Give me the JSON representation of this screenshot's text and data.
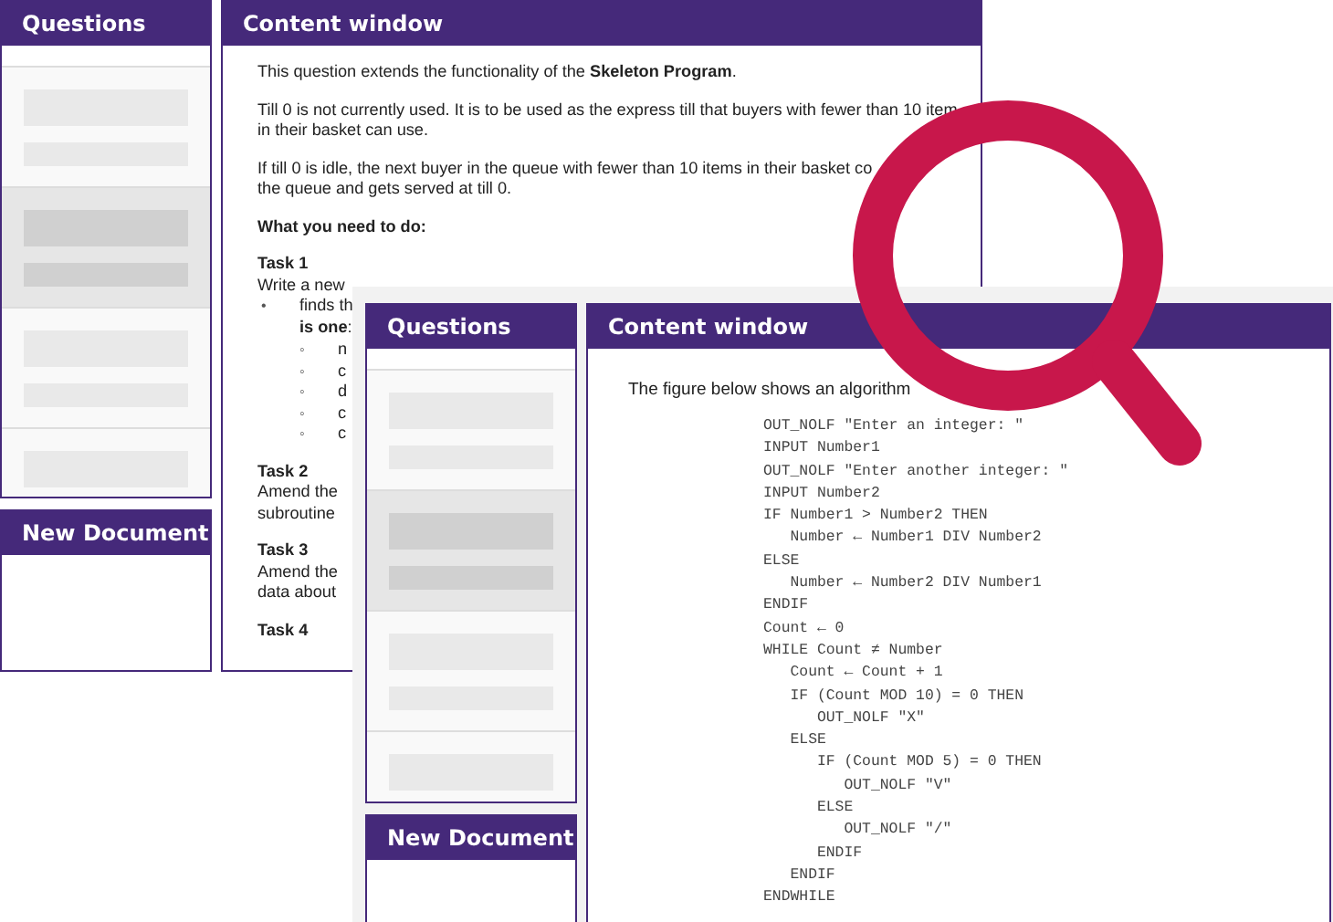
{
  "back_app": {
    "questions": {
      "title": "Questions",
      "items": [
        {
          "selected": false
        },
        {
          "selected": true
        },
        {
          "selected": false
        },
        {
          "selected": false
        }
      ]
    },
    "new_document": {
      "title": "New Document"
    },
    "content": {
      "title": "Content window",
      "blocks": [
        {
          "kind": "para",
          "lines": [
            "This question extends the functionality of the **Skeleton Program**."
          ]
        },
        {
          "kind": "para",
          "lines": [
            "Till 0 is not currently used. It is to be used as the express till that buyers with fewer than 10 item",
            "in their basket can use."
          ]
        },
        {
          "kind": "para",
          "lines": [
            "If till 0 is idle, the next buyer in the queue with fewer than 10 items in their basket co",
            "the queue and gets served at till 0."
          ]
        },
        {
          "kind": "heading",
          "lines": [
            "What you need to do:"
          ]
        },
        {
          "kind": "task",
          "lines": [
            "Task 1",
            "Write a new"
          ]
        },
        {
          "kind": "bullet",
          "mark": "•",
          "lines": [
            "finds th",
            "**is one**:"
          ]
        },
        {
          "kind": "subbullets",
          "mark": "◦",
          "lines": [
            "n",
            "c",
            "d",
            "c",
            "c"
          ]
        },
        {
          "kind": "task",
          "lines": [
            "Task 2",
            "Amend the",
            "subroutine"
          ]
        },
        {
          "kind": "task",
          "lines": [
            "Task 3",
            "Amend the",
            "data about"
          ]
        },
        {
          "kind": "heading",
          "lines": [
            "Task 4"
          ]
        }
      ]
    }
  },
  "front_app": {
    "questions": {
      "title": "Questions",
      "items": [
        {
          "selected": false
        },
        {
          "selected": true
        },
        {
          "selected": false
        },
        {
          "selected": false
        }
      ]
    },
    "new_document": {
      "title": "New Document"
    },
    "content": {
      "title": "Content window",
      "intro": "The figure below shows an algorithm",
      "code": [
        "OUT_NOLF \"Enter an integer: \"",
        "INPUT Number1",
        "OUT_NOLF \"Enter another integer: \"",
        "INPUT Number2",
        "IF Number1 > Number2 THEN",
        "   Number ← Number1 DIV Number2",
        "ELSE",
        "   Number ← Number2 DIV Number1",
        "ENDIF",
        "Count ← 0",
        "WHILE Count ≠ Number",
        "   Count ← Count + 1",
        "   IF (Count MOD 10) = 0 THEN",
        "      OUT_NOLF \"X\"",
        "   ELSE",
        "      IF (Count MOD 5) = 0 THEN",
        "         OUT_NOLF \"V\"",
        "      ELSE",
        "         OUT_NOLF \"/\"",
        "      ENDIF",
        "   ENDIF",
        "ENDWHILE"
      ]
    }
  }
}
